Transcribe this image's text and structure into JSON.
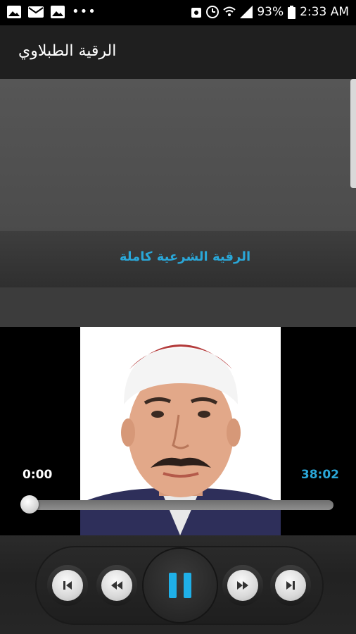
{
  "status_bar": {
    "notification_icons": [
      "image-icon",
      "mail-icon",
      "image-icon"
    ],
    "more_indicator": "•••",
    "battery_percent": "93%",
    "time": "2:33 AM",
    "system_icons": [
      "alarm-icon",
      "clock-icon",
      "wifi-icon",
      "signal-icon",
      "battery-icon"
    ]
  },
  "app_bar": {
    "title": "الرقية الطبلاوي"
  },
  "playlist": {
    "items": [
      {
        "title": "الرقية الشرعية كاملة"
      }
    ]
  },
  "player": {
    "elapsed": "0:00",
    "duration": "38:02",
    "progress": 0,
    "accent_color": "#2aa7d8",
    "state": "playing"
  },
  "controls": {
    "buttons": [
      "skip-previous-icon",
      "rewind-icon",
      "pause-icon",
      "fast-forward-icon",
      "skip-next-icon"
    ]
  }
}
